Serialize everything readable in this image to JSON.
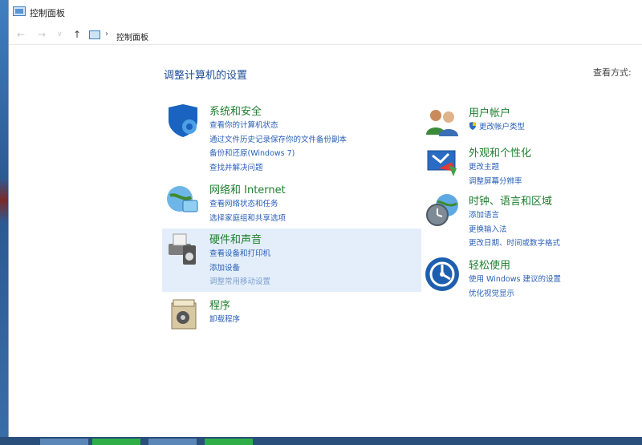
{
  "window": {
    "title": "控制面板"
  },
  "address_bar": {
    "back": "←",
    "forward": "→",
    "dropdown": "∨",
    "up": "↑",
    "breadcrumb_sep": "›",
    "breadcrumb": "控制面板"
  },
  "main": {
    "title": "调整计算机的设置",
    "view_by_label": "查看方式:"
  },
  "categories_left": [
    {
      "name": "系统和安全",
      "icon": "shield-icon",
      "links": [
        "查看你的计算机状态",
        "通过文件历史记录保存你的文件备份副本",
        "备份和还原(Windows 7)",
        "查找并解决问题"
      ]
    },
    {
      "name": "网络和 Internet",
      "icon": "network-globe-icon",
      "links": [
        "查看网络状态和任务",
        "选择家庭组和共享选项"
      ]
    },
    {
      "name": "硬件和声音",
      "icon": "printer-speaker-icon",
      "links": [
        "查看设备和打印机",
        "添加设备",
        "调整常用移动设置"
      ]
    },
    {
      "name": "程序",
      "icon": "programs-box-icon",
      "links": [
        "卸载程序"
      ]
    }
  ],
  "categories_right": [
    {
      "name": "用户帐户",
      "icon": "users-icon",
      "links": [
        "更改帐户类型"
      ]
    },
    {
      "name": "外观和个性化",
      "icon": "appearance-icon",
      "links": [
        "更改主题",
        "调整屏幕分辨率"
      ]
    },
    {
      "name": "时钟、语言和区域",
      "icon": "clock-globe-icon",
      "links": [
        "添加语言",
        "更换输入法",
        "更改日期、时间或数字格式"
      ]
    },
    {
      "name": "轻松使用",
      "icon": "ease-of-access-icon",
      "links": [
        "使用 Windows 建议的设置",
        "优化视觉显示"
      ]
    }
  ],
  "colors": {
    "heading_green": "#1e7f2e",
    "link_blue": "#2a5fb8",
    "title_blue": "#1f4e9a",
    "hover_bg": "#e3eefa"
  }
}
